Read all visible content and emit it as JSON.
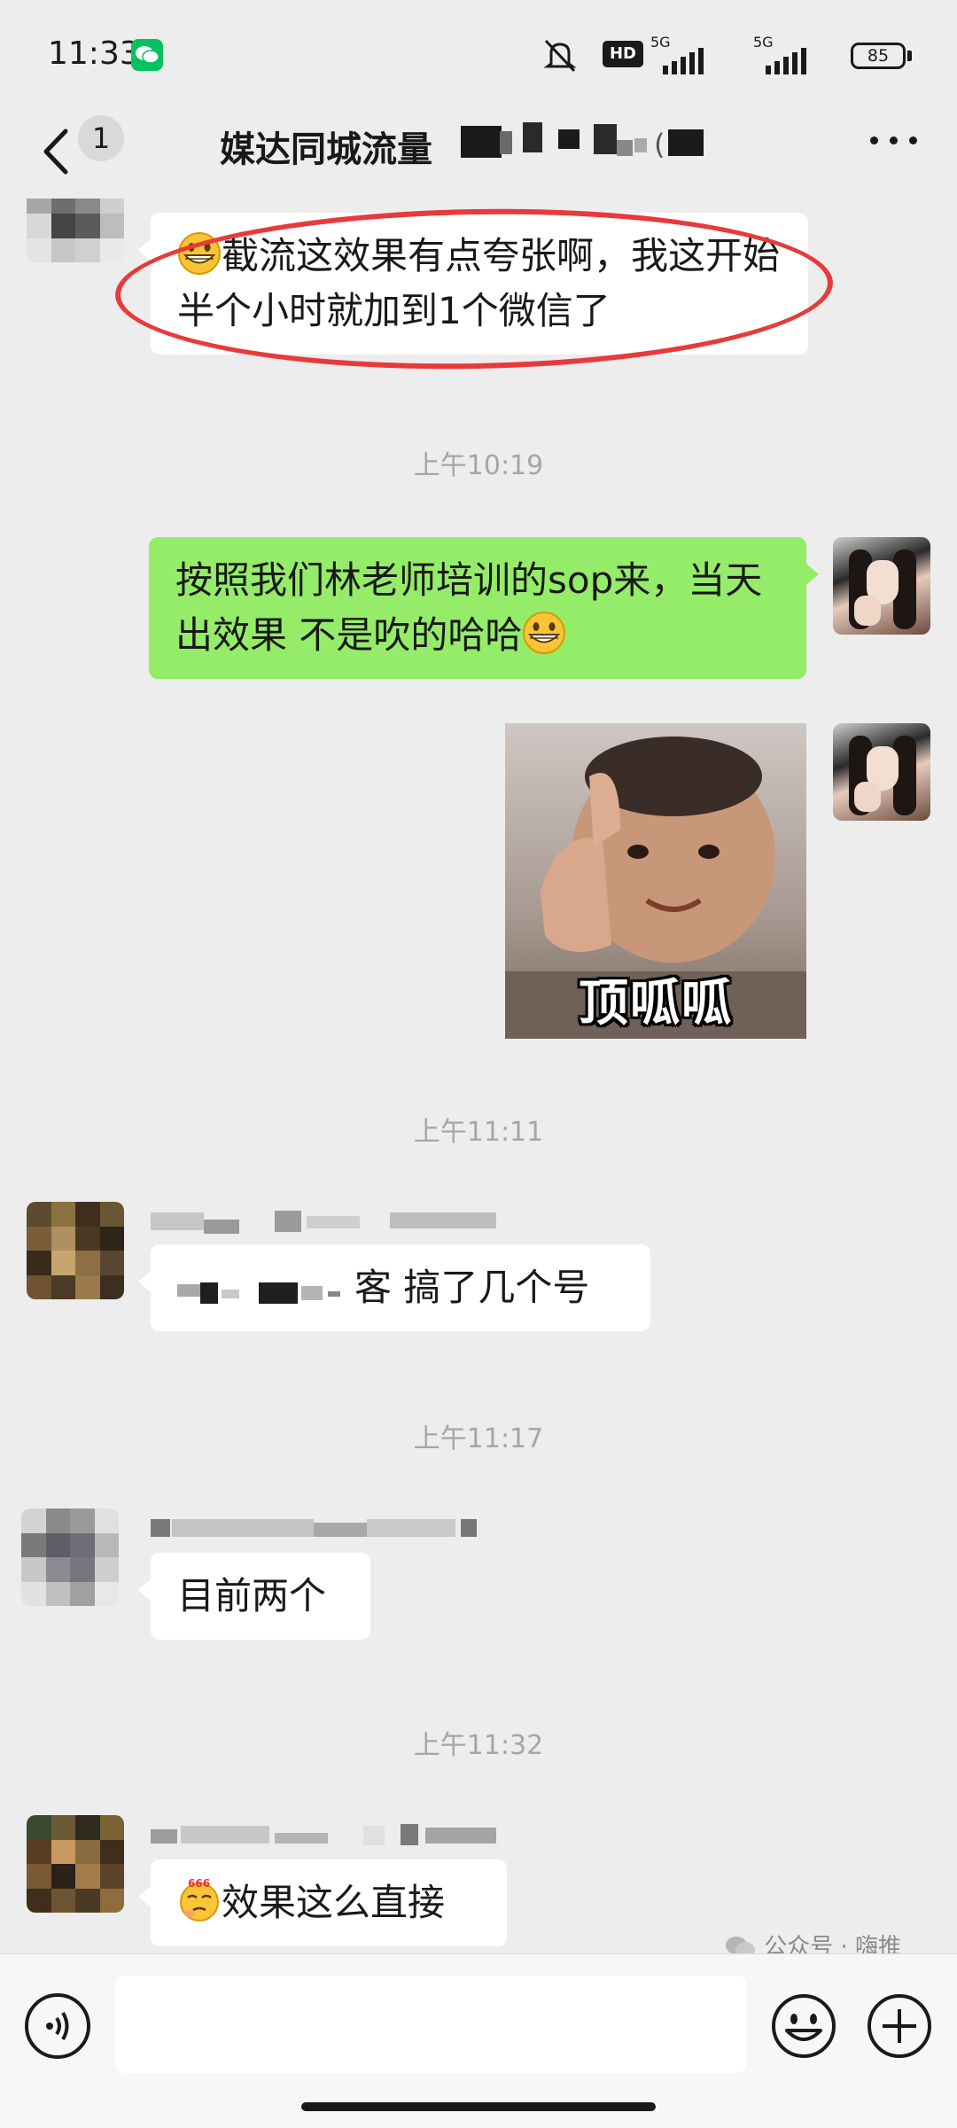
{
  "status_bar": {
    "time": "11:33",
    "hd_label": "HD",
    "signal1_label": "5G",
    "signal2_label": "5G",
    "battery": "85"
  },
  "header": {
    "unread_count": "1",
    "title": "媒达同城流量"
  },
  "messages": [
    {
      "id": "m1",
      "side": "left",
      "text": "截流这效果有点夸张啊，我这开始半个小时就加到1个微信了",
      "emoji": "grinning-face"
    },
    {
      "id": "t1",
      "type": "timestamp",
      "text": "上午10:19"
    },
    {
      "id": "m2",
      "side": "right",
      "text": "按照我们林老师培训的sop来，当天出效果 不是吹的哈哈",
      "emoji": "grinning-face"
    },
    {
      "id": "m3",
      "side": "right",
      "type": "sticker",
      "caption": "顶呱呱"
    },
    {
      "id": "t2",
      "type": "timestamp",
      "text": "上午11:11"
    },
    {
      "id": "m4",
      "side": "left",
      "text": "客  搞了几个号"
    },
    {
      "id": "t3",
      "type": "timestamp",
      "text": "上午11:17"
    },
    {
      "id": "m5",
      "side": "left",
      "text": "目前两个"
    },
    {
      "id": "t4",
      "type": "timestamp",
      "text": "上午11:32"
    },
    {
      "id": "m6",
      "side": "left",
      "text": "效果这么直接",
      "emoji": "666-thinking-face"
    }
  ],
  "input_bar": {
    "placeholder": ""
  },
  "watermark": "公众号 · 嗨推",
  "colors": {
    "background": "#ededed",
    "bubble_self": "#95ec69",
    "bubble_other": "#ffffff",
    "highlight_oval": "#e83a3a",
    "wechat_green": "#07c160"
  }
}
